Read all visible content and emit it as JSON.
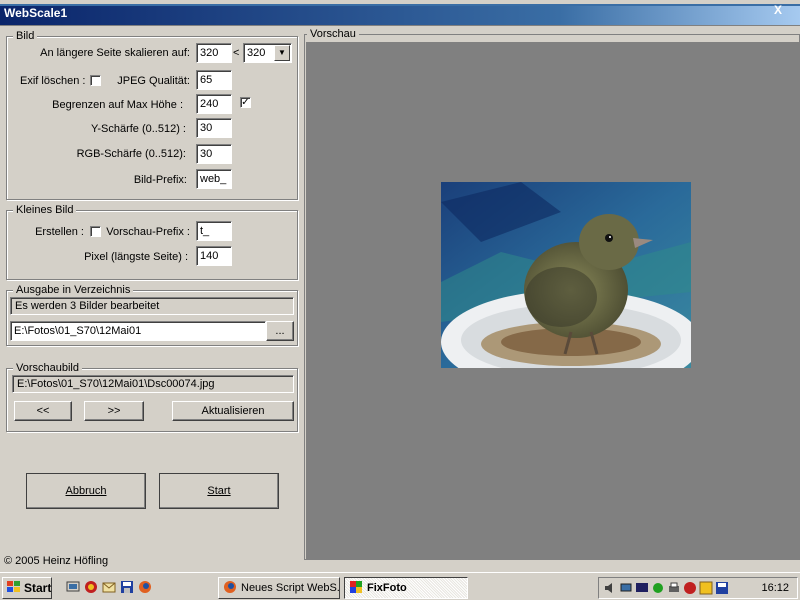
{
  "window": {
    "title": "WebScale1",
    "close_glyph": "X"
  },
  "bild": {
    "legend": "Bild",
    "scale_label": "An längere Seite skalieren auf:",
    "scale_value": "320",
    "lt": "<",
    "scale_combo": "320",
    "exif_label": "Exif löschen :",
    "exif_checked": false,
    "jpeg_label": "JPEG Qualität:",
    "jpeg_value": "65",
    "maxh_label": "Begrenzen auf Max Höhe :",
    "maxh_value": "240",
    "maxh_checked": "✓",
    "y_label": "Y-Schärfe (0..512) :",
    "y_value": "30",
    "rgb_label": "RGB-Schärfe (0..512):",
    "rgb_value": "30",
    "prefix_label": "Bild-Prefix:",
    "prefix_value": "web_"
  },
  "klein": {
    "legend": "Kleines Bild",
    "erstellen_label": "Erstellen :",
    "vorschau_prefix_label": "Vorschau-Prefix :",
    "vorschau_prefix_value": "t_",
    "pixel_label": "Pixel (längste Seite) :",
    "pixel_value": "140"
  },
  "ausgabe": {
    "legend": "Ausgabe in Verzeichnis",
    "status": "Es werden 3 Bilder bearbeitet",
    "path": "E:\\Fotos\\01_S70\\12Mai01",
    "browse": "..."
  },
  "vorschaubild": {
    "legend": "Vorschaubild",
    "file": "E:\\Fotos\\01_S70\\12Mai01\\Dsc00074.jpg",
    "prev": "<<",
    "next": ">>",
    "refresh": "Aktualisieren"
  },
  "actions": {
    "cancel": "Abbruch",
    "start": "Start"
  },
  "footer": {
    "copyright": "© 2005 Heinz Höfling"
  },
  "preview": {
    "legend": "Vorschau"
  },
  "taskbar": {
    "start": "Start",
    "tasks": [
      "Neues Script WebS...",
      "FixFoto"
    ],
    "clock": "16:12"
  },
  "icons": {
    "start": "windows-logo-icon",
    "ql": [
      "desktop-icon",
      "browser-icon",
      "mail-icon",
      "save-icon",
      "firefox-icon"
    ],
    "tray": [
      "speaker-icon",
      "network-icon",
      "monitor-icon",
      "tool-icon",
      "printer-icon",
      "antivirus-icon",
      "app-icon",
      "disk-icon"
    ]
  },
  "colors": {
    "title_start": "#0a246a",
    "preview_bg": "#808080",
    "face": "#d4d0c8"
  }
}
